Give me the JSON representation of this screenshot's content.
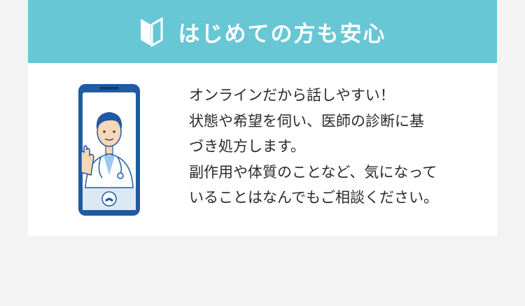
{
  "banner": {
    "icon": "beginner-mark-icon",
    "title": "はじめての方も安心"
  },
  "illustration": {
    "icon": "doctor-video-call-icon",
    "call_button_icon": "phone-hangup-icon"
  },
  "message": {
    "lines": [
      "オンラインだから話しやすい！",
      "状態や希望を伺い、医師の診断に基",
      "づき処方します。",
      "副作用や体質のことなど、気になって",
      "いることはなんでもご相談ください。"
    ]
  },
  "colors": {
    "banner_bg": "#67c7d5",
    "card_bg": "#ffffff",
    "page_bg": "#f3f3f3",
    "phone_frame": "#1f5aa3",
    "text": "#2b2b2b"
  }
}
